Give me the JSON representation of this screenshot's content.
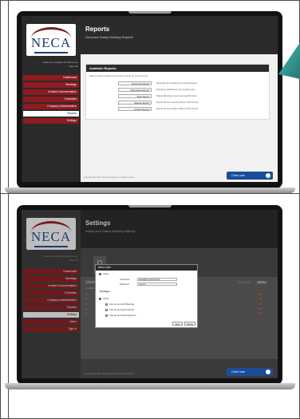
{
  "reports_screen": {
    "logo": "NECA",
    "signed_in": "Welcome user@neca-demo.com",
    "sign_out": "Sign Out",
    "menu": [
      {
        "label": "Dashboard",
        "active": false
      },
      {
        "label": "Meetings",
        "active": false
      },
      {
        "label": "Incident Documentation",
        "active": false
      },
      {
        "label": "Checklists",
        "active": false
      },
      {
        "label": "Company Administration",
        "active": false
      },
      {
        "label": "Reports",
        "active": true
      },
      {
        "label": "Settings",
        "active": false
      }
    ],
    "header": {
      "title": "Reports",
      "subtitle": "Generate Safety Meeting Reports"
    },
    "panel": {
      "title": "Available Reports",
      "intro": "Select a button below to generate a report for your account",
      "reports": [
        {
          "button": "Employee Report",
          "desc": "Meetings and Incidents for all Employees"
        },
        {
          "button": "Attendance Report",
          "desc": "Employee Attendance by meeting topic"
        },
        {
          "button": "Topic Report",
          "desc": "Safety Meetings covering a specific topic"
        },
        {
          "button": "Meeting Export",
          "desc": "Export All raw meeting data in CSV format"
        },
        {
          "button": "Incident Export",
          "desc": "Export All raw incident data in CSV format"
        }
      ]
    },
    "footer": "Copyright 2017 NECA Safety Meeting App. All rights reserved.",
    "chat": "Chat now"
  },
  "settings_screen": {
    "logo": "NECA",
    "signed_in": "Welcome user@neca-demo.com",
    "sign_out": "Sign Out",
    "menu": [
      {
        "label": "Dashboard",
        "active": false
      },
      {
        "label": "Meetings",
        "active": false
      },
      {
        "label": "Incident Documentation",
        "active": false
      },
      {
        "label": "Checklists",
        "active": false
      },
      {
        "label": "Company Administration",
        "active": false
      },
      {
        "label": "Reports",
        "active": false
      },
      {
        "label": "Settings",
        "active": true
      },
      {
        "label": "Users",
        "active": false
      },
      {
        "label": "Sign In",
        "active": false
      }
    ],
    "header": {
      "title": "Settings",
      "subtitle": "Adjust your Safety Meeting settings"
    },
    "gear_label": "User",
    "users_title": "Users",
    "available_label": "Available Users",
    "add_label": "Add User",
    "modal": {
      "title": "Add a User",
      "active_label": "Active",
      "username_label": "Username",
      "username_value": "demo@neca-demo.com",
      "password_label": "Password",
      "password_value": "••••••••••",
      "privileges_label": "Privileges",
      "admin_label": "Admin",
      "options": [
        "Can set and edit Meetings",
        "Can set and edit Incidents",
        "Can set and edit Employees"
      ],
      "cancel": "Cancel",
      "save": "Save"
    },
    "footer": "Copyright 2017 NECA Safety Meeting App. All rights reserved.",
    "chat": "Chat now"
  }
}
